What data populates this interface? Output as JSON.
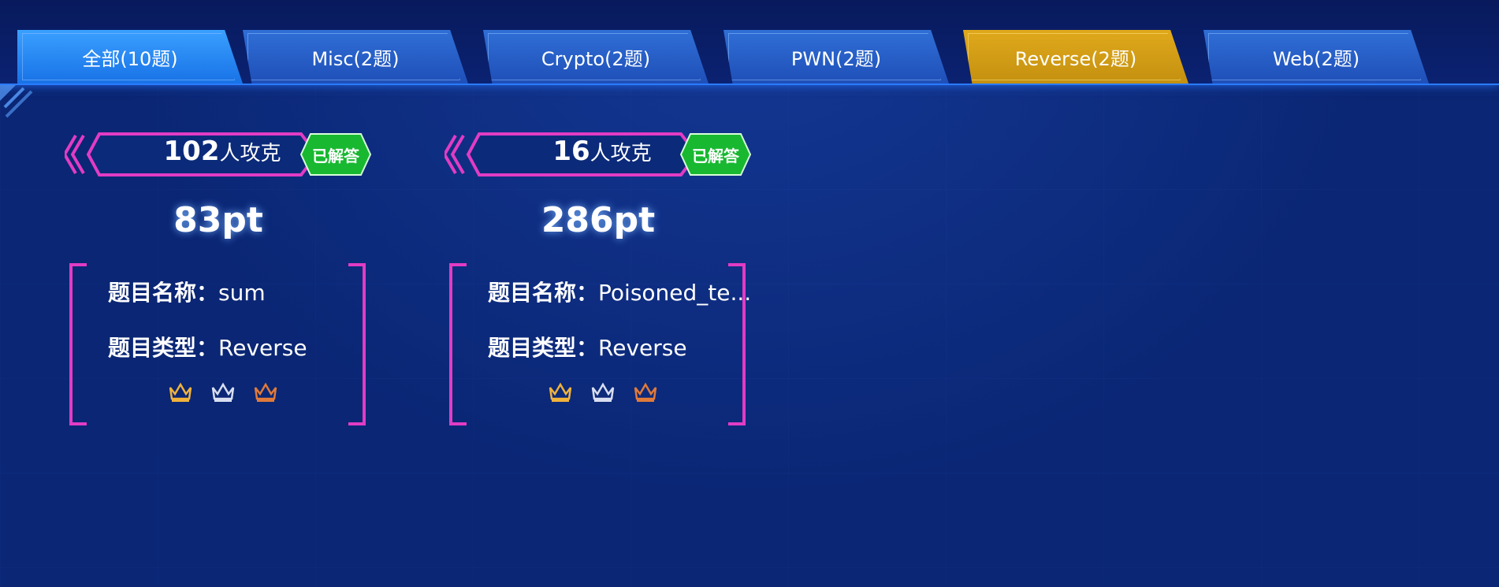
{
  "tabs": [
    {
      "label": "全部(10题)"
    },
    {
      "label": "Misc(2题)"
    },
    {
      "label": "Crypto(2题)"
    },
    {
      "label": "PWN(2题)"
    },
    {
      "label": "Reverse(2题)"
    },
    {
      "label": "Web(2题)"
    }
  ],
  "active_tab": "Reverse(2题)",
  "colors": {
    "background": "#0a2675",
    "tab_blue": "#1f4fb8",
    "tab_active": "#c4900f",
    "magenta": "#e23cc4",
    "badge_green": "#18b830",
    "gold": "#f0b23c",
    "silver": "#d8def0",
    "bronze": "#e07a3a"
  },
  "cards": [
    {
      "solvers_count": "102",
      "solvers_suffix": "人攻克",
      "badge": "已解答",
      "points": "83pt",
      "name_key": "题目名称：",
      "name_value": "sum",
      "type_key": "题目类型：",
      "type_value": "Reverse",
      "icons": [
        "gold-crown-icon",
        "silver-crown-icon",
        "bronze-crown-icon"
      ]
    },
    {
      "solvers_count": "16",
      "solvers_suffix": "人攻克",
      "badge": "已解答",
      "points": "286pt",
      "name_key": "题目名称：",
      "name_value": "Poisoned_te...",
      "type_key": "题目类型：",
      "type_value": "Reverse",
      "icons": [
        "gold-crown-icon",
        "silver-crown-icon",
        "bronze-crown-icon"
      ]
    }
  ]
}
